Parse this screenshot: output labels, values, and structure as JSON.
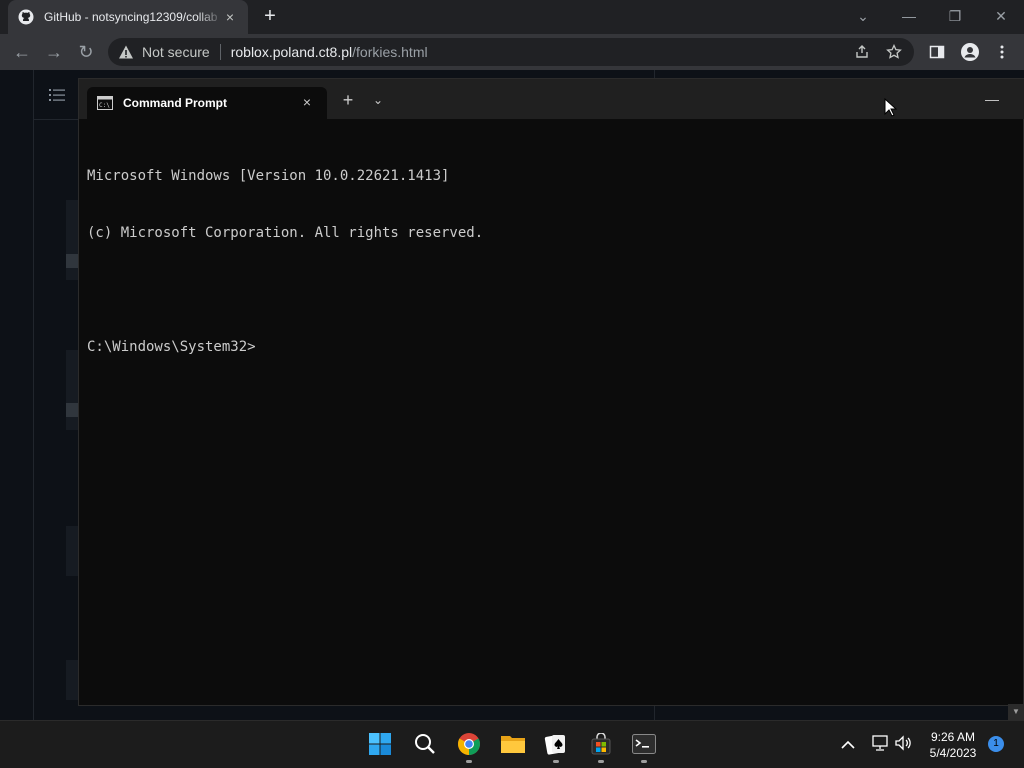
{
  "browser": {
    "tab_title": "GitHub - notsyncing12309/collab",
    "tab_close": "×",
    "new_tab": "+",
    "window_controls": {
      "dropdown": "⌄",
      "minimize": "—",
      "restore": "❐",
      "close": "✕"
    },
    "nav": {
      "back": "←",
      "forward": "→",
      "reload": "↻"
    },
    "address": {
      "security_label": "Not secure",
      "host": "roblox.poland.ct8.pl",
      "path": "/forkies.html"
    },
    "icons": [
      "github-icon",
      "warning-icon",
      "share-icon",
      "star-icon",
      "side-panel-icon",
      "profile-icon",
      "menu-icon"
    ]
  },
  "terminal": {
    "tab_title": "Command Prompt",
    "tab_close": "×",
    "new_tab": "+",
    "dropdown": "⌄",
    "minimize": "—",
    "lines": [
      "Microsoft Windows [Version 10.0.22621.1413]",
      "(c) Microsoft Corporation. All rights reserved.",
      "",
      "C:\\Windows\\System32>"
    ]
  },
  "taskbar": {
    "apps": [
      "start",
      "search",
      "chrome",
      "file-explorer",
      "solitaire",
      "store",
      "terminal"
    ],
    "tray": {
      "chevron": "^",
      "time": "9:26 AM",
      "date": "5/4/2023",
      "notification_count": "1"
    }
  },
  "colors": {
    "chrome_dark": "#202124",
    "terminal_bg": "#0c0c0c",
    "page_bg": "#0d1117",
    "taskbar_bg": "#1c1c1c",
    "accent": "#3b8eea"
  }
}
